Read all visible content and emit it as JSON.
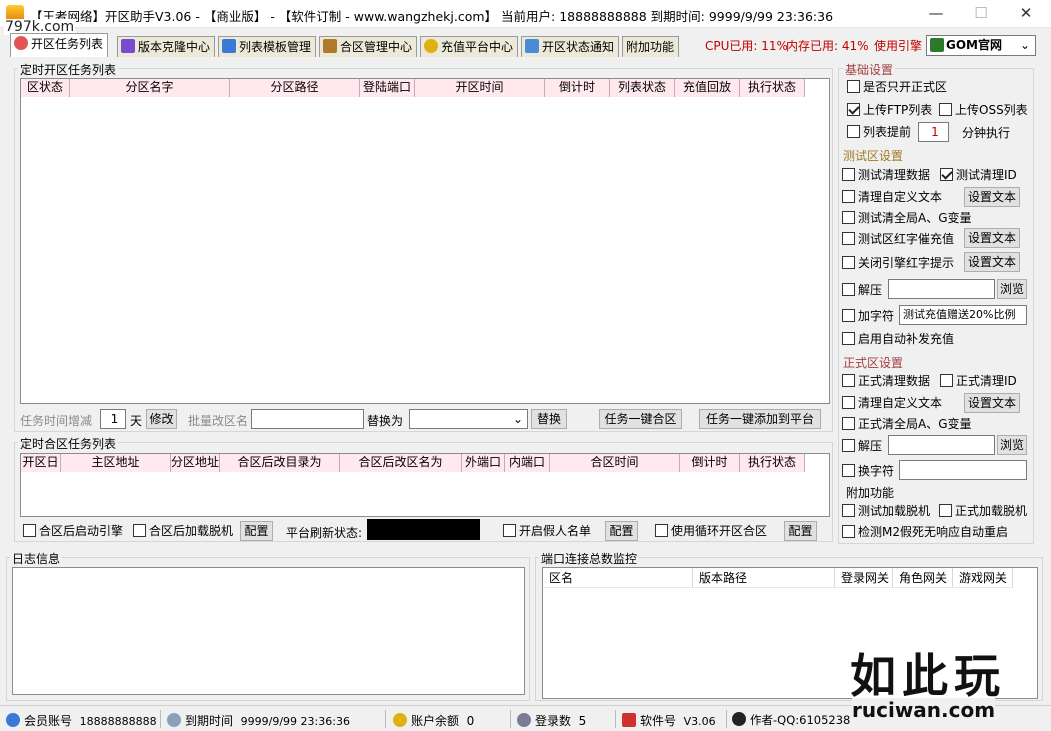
{
  "window": {
    "title": "【王者网络】开区助手V3.06 - 【商业版】 - 【软件订制 - www.wangzhekj.com】 当前用户: 18888888888 到期时间: 9999/9/99 23:36:36",
    "min": "—",
    "max": "☐",
    "close": "✕"
  },
  "watermark_tl": "797k.com",
  "tabs": [
    {
      "label": "开区任务列表",
      "color": "#e25555"
    },
    {
      "label": "版本克隆中心",
      "color": "#7a4bd1"
    },
    {
      "label": "列表模板管理",
      "color": "#3a7ad6"
    },
    {
      "label": "合区管理中心",
      "color": "#b07a2a"
    },
    {
      "label": "充值平台中心",
      "color": "#e0b010"
    },
    {
      "label": "开区状态通知",
      "color": "#4a8ad6"
    },
    {
      "label": "附加功能",
      "color": ""
    }
  ],
  "status": {
    "cpu_label": "CPU已用:",
    "cpu": "11%",
    "mem_label": "内存已用:",
    "mem": "41%",
    "engine_label": "使用引擎",
    "engine": "GOM官网"
  },
  "task": {
    "group_title": "定时开区任务列表",
    "columns": [
      "区状态",
      "分区名字",
      "分区路径",
      "登陆端口",
      "开区时间",
      "倒计时",
      "列表状态",
      "充值回放",
      "执行状态"
    ],
    "time_inc_label": "任务时间增减",
    "days_value": "1",
    "days_unit": "天",
    "modify": "修改",
    "rename_label": "批量改区名",
    "replace_label": "替换为",
    "replace_btn": "替换",
    "merge_btn": "任务一键合区",
    "add_platform_btn": "任务一键添加到平台"
  },
  "merge": {
    "group_title": "定时合区任务列表",
    "columns": [
      "开区日",
      "主区地址",
      "分区地址",
      "合区后改目录为",
      "合区后改区名为",
      "外端口",
      "内端口",
      "合区时间",
      "倒计时",
      "执行状态"
    ],
    "start_engine": "合区后启动引擎",
    "load_offline": "合区后加载脱机",
    "config": "配置",
    "refresh_label": "平台刷新状态:",
    "fake_list": "开启假人名单",
    "loop_merge": "使用循环开区合区"
  },
  "basic": {
    "title": "基础设置",
    "formal_only": "是否只开正式区",
    "ftp": "上传FTP列表",
    "oss": "上传OSS列表",
    "advance": "列表提前",
    "advance_value": "1",
    "advance_unit": "分钟执行"
  },
  "test": {
    "title": "测试区设置",
    "clear_data": "测试清理数据",
    "clear_id": "测试清理ID",
    "clear_custom": "清理自定义文本",
    "set_text": "设置文本",
    "clear_global": "测试清全局A、G变量",
    "red_recharge": "测试区红字催充值",
    "close_red": "关闭引擎红字提示",
    "unzip": "解压",
    "browse": "浏览",
    "add_char": "加字符",
    "add_char_value": "测试充值赠送20%比例",
    "auto_recharge": "启用自动补发充值"
  },
  "formal": {
    "title": "正式区设置",
    "clear_data": "正式清理数据",
    "clear_id": "正式清理ID",
    "clear_custom": "清理自定义文本",
    "set_text": "设置文本",
    "clear_global": "正式清全局A、G变量",
    "unzip": "解压",
    "browse": "浏览",
    "swap_char": "换字符"
  },
  "extra": {
    "title": "附加功能",
    "test_load": "测试加载脱机",
    "formal_load": "正式加载脱机",
    "detect_m2": "检测M2假死无响应自动重启"
  },
  "log": {
    "title": "日志信息"
  },
  "port": {
    "title": "端口连接总数监控",
    "columns": [
      "区名",
      "版本路径",
      "登录网关",
      "角色网关",
      "游戏网关"
    ]
  },
  "watermark_br": {
    "big": "如此玩",
    "url": "ruciwan.com"
  },
  "footer": {
    "member_label": "会员账号",
    "member": "18888888888",
    "expire_label": "到期时间",
    "expire": "9999/9/99 23:36:36",
    "balance_label": "账户余额",
    "balance": "0",
    "login_label": "登录数",
    "login": "5",
    "soft_label": "软件号",
    "soft": "V3.06",
    "author": "作者-QQ:6105238"
  }
}
